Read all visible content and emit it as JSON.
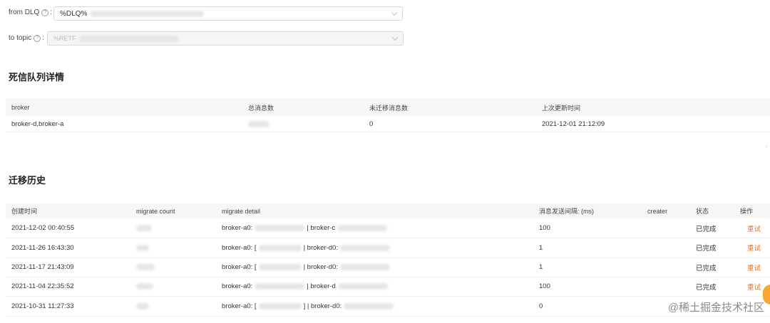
{
  "form": {
    "from_label": "from DLQ",
    "from_value": "%DLQ%",
    "to_label": "to topic",
    "to_value": "%RETF",
    "help_glyph": "?",
    "colon": ":"
  },
  "dlq_section": {
    "title": "死信队列详情",
    "columns": [
      "broker",
      "总消息数",
      "未迁移消息数",
      "上次更新时间"
    ],
    "row": {
      "broker": "broker-d,broker-a",
      "total": "",
      "unmigrated": "0",
      "updated": "2021-12-01 21:12:09"
    }
  },
  "history_section": {
    "title": "迁移历史",
    "columns": [
      "创建时间",
      "migrate count",
      "migrate detail",
      "消息发送间隔: (ms)",
      "creater",
      "状态",
      "操作"
    ],
    "rows": [
      {
        "created": "2021-12-02 00:40:55",
        "detail_a": "broker-a0:",
        "detail_sep": "| broker-c",
        "interval": "100",
        "status": "已完成",
        "action": "重试"
      },
      {
        "created": "2021-11-26 16:43:30",
        "detail_a": "broker-a0: [",
        "detail_sep": "| broker-d0:",
        "interval": "1",
        "status": "已完成",
        "action": "重试"
      },
      {
        "created": "2021-11-17 21:43:09",
        "detail_a": "broker-a0: [",
        "detail_sep": "| broker-d0:",
        "interval": "1",
        "status": "已完成",
        "action": "重试"
      },
      {
        "created": "2021-11-04 22:35:52",
        "detail_a": "broker-a0:",
        "detail_sep": "| broker-d",
        "interval": "100",
        "status": "已完成",
        "action": "重试"
      },
      {
        "created": "2021-10-31 11:27:33",
        "detail_a": "broker-a0: [",
        "detail_sep": "] | broker-d0:",
        "interval": "0",
        "status": "已完成",
        "action": "重试"
      }
    ]
  },
  "watermark": "@稀土掘金技术社区",
  "icons": {
    "side_arrow": "chevron-left-icon",
    "select_arrow": "chevron-down-icon"
  }
}
